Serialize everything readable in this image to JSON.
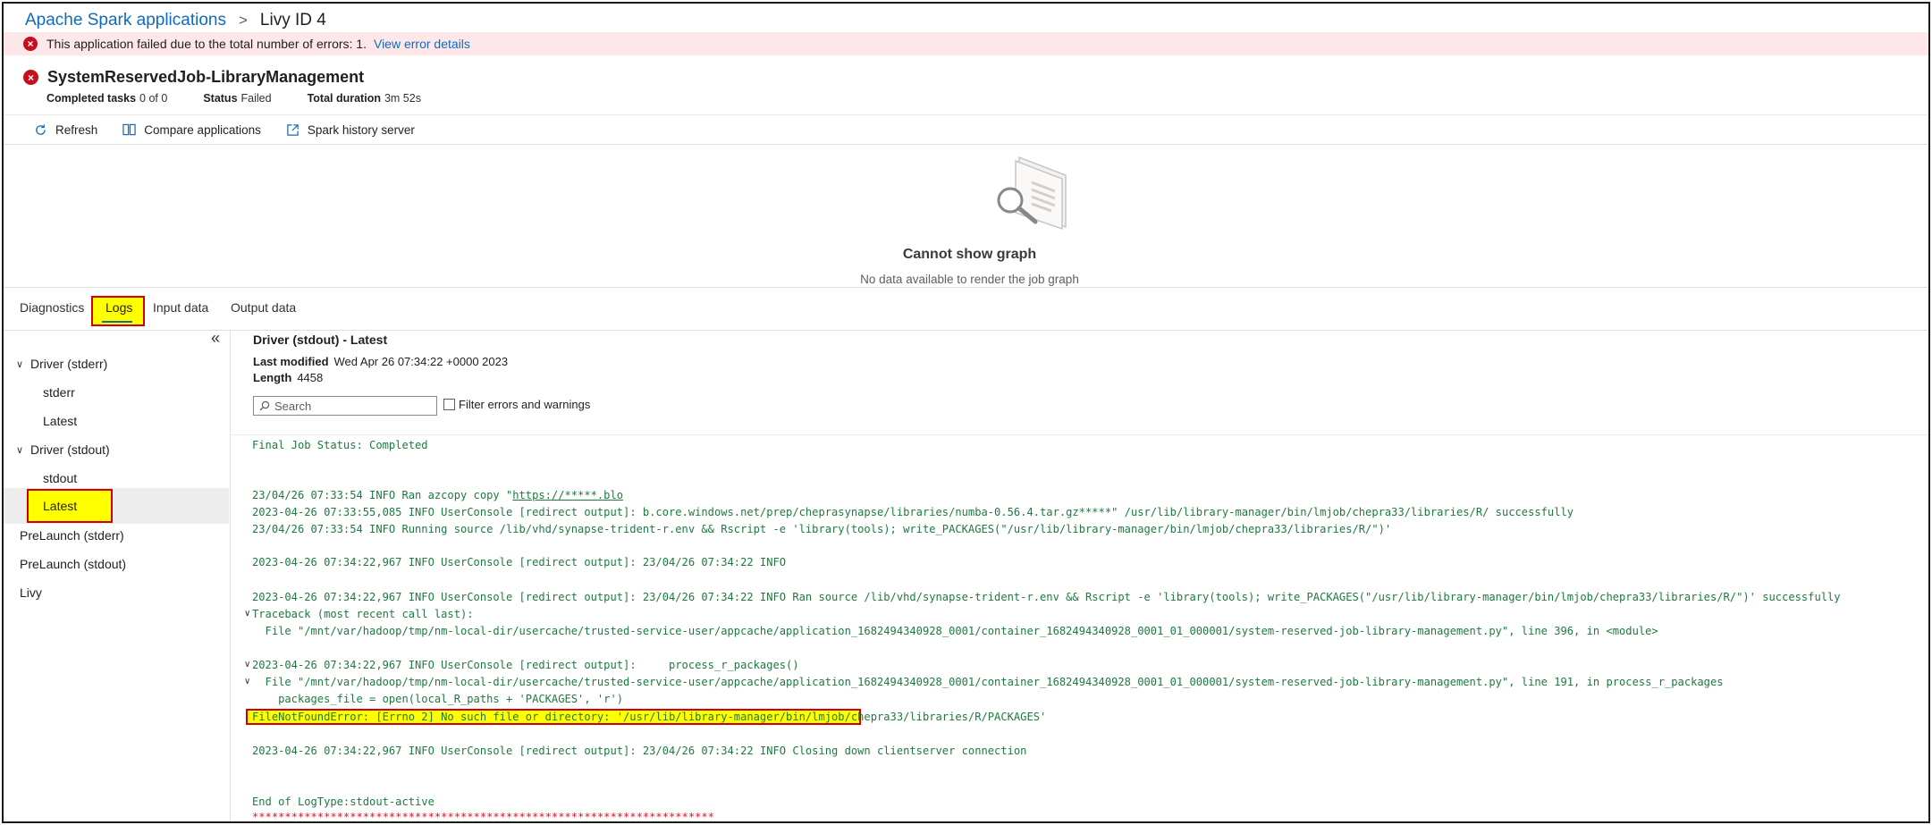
{
  "breadcrumb": {
    "root": "Apache Spark applications",
    "separator": ">",
    "current": "Livy ID 4"
  },
  "error_banner": {
    "icon": "error-circle-icon",
    "message": "This application failed due to the total number of errors: 1.",
    "link": "View error details"
  },
  "app": {
    "title": "SystemReservedJob-LibraryManagement",
    "meta": [
      {
        "label": "Completed tasks",
        "value": "0 of 0"
      },
      {
        "label": "Status",
        "value": "Failed"
      },
      {
        "label": "Total duration",
        "value": "3m 52s"
      }
    ]
  },
  "toolbar": {
    "refresh": "Refresh",
    "compare": "Compare applications",
    "history": "Spark history server"
  },
  "graph": {
    "title": "Cannot show graph",
    "subtitle": "No data available to render the job graph"
  },
  "tabs": [
    "Diagnostics",
    "Logs",
    "Input data",
    "Output data"
  ],
  "sidebar": {
    "collapse_glyph": "«",
    "items": [
      {
        "label": "Driver (stderr)",
        "expanded": true
      },
      {
        "label": "stderr"
      },
      {
        "label": "Latest"
      },
      {
        "label": "Driver (stdout)",
        "expanded": true
      },
      {
        "label": "stdout"
      },
      {
        "label": "Latest",
        "selected": true
      },
      {
        "label": "PreLaunch (stderr)"
      },
      {
        "label": "PreLaunch (stdout)"
      },
      {
        "label": "Livy"
      }
    ]
  },
  "log": {
    "title": "Driver (stdout) - Latest",
    "last_modified_label": "Last modified",
    "last_modified": "Wed Apr 26 07:34:22 +0000 2023",
    "length_label": "Length",
    "length": "4458",
    "search_placeholder": "Search",
    "filter_label": "Filter errors and warnings",
    "lines": {
      "l0": "Final Job Status: Completed",
      "l1a": "23/04/26 07:33:54 INFO Ran azcopy copy \"",
      "l1b": "https://*****.blo",
      "l2": "2023-04-26 07:33:55,085 INFO UserConsole [redirect output]: b.core.windows.net/prep/cheprasynapse/libraries/numba-0.56.4.tar.gz*****\" /usr/lib/library-manager/bin/lmjob/chepra33/libraries/R/ successfully",
      "l3": "23/04/26 07:33:54 INFO Running source /lib/vhd/synapse-trident-r.env && Rscript -e 'library(tools); write_PACKAGES(\"/usr/lib/library-manager/bin/lmjob/chepra33/libraries/R/\")'",
      "l4": "2023-04-26 07:34:22,967 INFO UserConsole [redirect output]: 23/04/26 07:34:22 INFO",
      "l5": "2023-04-26 07:34:22,967 INFO UserConsole [redirect output]: 23/04/26 07:34:22 INFO Ran source /lib/vhd/synapse-trident-r.env && Rscript -e 'library(tools); write_PACKAGES(\"/usr/lib/library-manager/bin/lmjob/chepra33/libraries/R/\")' successfully",
      "l6": "Traceback (most recent call last):",
      "l7": "  File \"/mnt/var/hadoop/tmp/nm-local-dir/usercache/trusted-service-user/appcache/application_1682494340928_0001/container_1682494340928_0001_01_000001/system-reserved-job-library-management.py\", line 396, in <module>",
      "l8": "2023-04-26 07:34:22,967 INFO UserConsole [redirect output]:     process_r_packages()",
      "l9": "  File \"/mnt/var/hadoop/tmp/nm-local-dir/usercache/trusted-service-user/appcache/application_1682494340928_0001/container_1682494340928_0001_01_000001/system-reserved-job-library-management.py\", line 191, in process_r_packages",
      "l10": "    packages_file = open(local_R_paths + 'PACKAGES', 'r')",
      "l11": "FileNotFoundError: [Errno 2] No such file or directory: '/usr/lib/library-manager/bin/lmjob/chepra33/libraries/R/PACKAGES'",
      "l12": "2023-04-26 07:34:22,967 INFO UserConsole [redirect output]: 23/04/26 07:34:22 INFO Closing down clientserver connection",
      "l13": "End of LogType:stdout-active",
      "l14": "***********************************************************************"
    }
  },
  "colors": {
    "link": "#0f6cbd",
    "error": "#c50f1f",
    "log_text": "#1e7a40",
    "highlight": "#ffff00",
    "highlight_border": "#d00000"
  }
}
